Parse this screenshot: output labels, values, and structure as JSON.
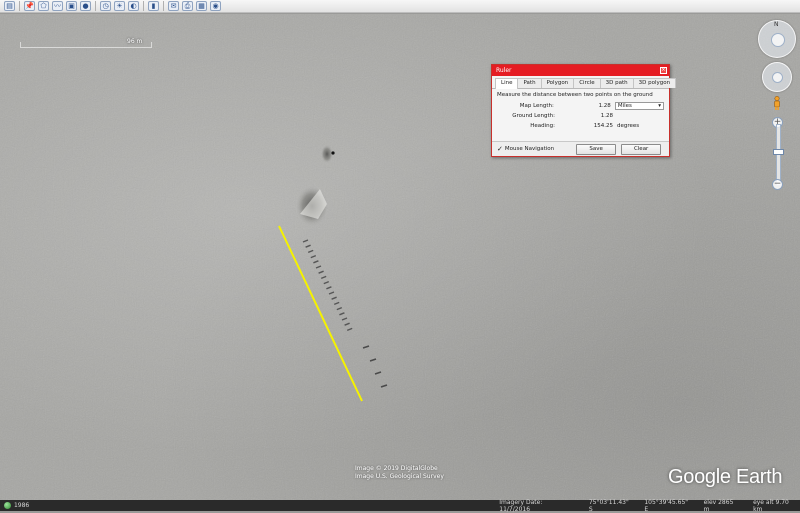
{
  "toolbar": {
    "buttons": [
      {
        "name": "sidebar-toggle-button",
        "icon": "▤"
      },
      {
        "name": "add-placemark-button",
        "icon": "📌"
      },
      {
        "name": "add-polygon-button",
        "icon": "⬠"
      },
      {
        "name": "add-path-button",
        "icon": "〰"
      },
      {
        "name": "add-overlay-button",
        "icon": "▣"
      },
      {
        "name": "record-tour-button",
        "icon": "●"
      },
      {
        "name": "historical-imagery-button",
        "icon": "◷"
      },
      {
        "name": "sunlight-button",
        "icon": "☀"
      },
      {
        "name": "planets-button",
        "icon": "◐"
      },
      {
        "name": "ruler-button",
        "icon": "▮"
      },
      {
        "name": "email-button",
        "icon": "✉"
      },
      {
        "name": "print-button",
        "icon": "⎙"
      },
      {
        "name": "save-image-button",
        "icon": "▦"
      },
      {
        "name": "view-in-maps-button",
        "icon": "◉"
      }
    ]
  },
  "scale": {
    "label": "96 m"
  },
  "ruler": {
    "title": "Ruler",
    "close_icon": "×",
    "tabs": [
      "Line",
      "Path",
      "Polygon",
      "Circle",
      "3D path",
      "3D polygon"
    ],
    "active_tab": 0,
    "description": "Measure the distance between two points on the ground",
    "map_length_label": "Map Length:",
    "map_length_value": "1.28",
    "unit": "Miles",
    "ground_length_label": "Ground Length:",
    "ground_length_value": "1.28",
    "heading_label": "Heading:",
    "heading_value": "154.25",
    "heading_unit": "degrees",
    "mouse_nav_label": "Mouse Navigation",
    "mouse_nav_checked": true,
    "save_label": "Save",
    "clear_label": "Clear"
  },
  "attribution": {
    "line1": "Image © 2019 DigitalGlobe",
    "line2": "Image U.S. Geological Survey"
  },
  "logo": "Google Earth",
  "statusbar": {
    "tour_label": "1986",
    "imagery_date": "Imagery Date: 11/7/2016",
    "lat": "75°03'11.43\" S",
    "lon": "105°39'45.65\" E",
    "elev": "elev 2865 m",
    "eye_alt": "eye alt 9.70 km"
  },
  "colors": {
    "ruler_line": "#f5f200",
    "ruler_titlebar": "#e51c23",
    "snow": "#a6a6a3"
  }
}
